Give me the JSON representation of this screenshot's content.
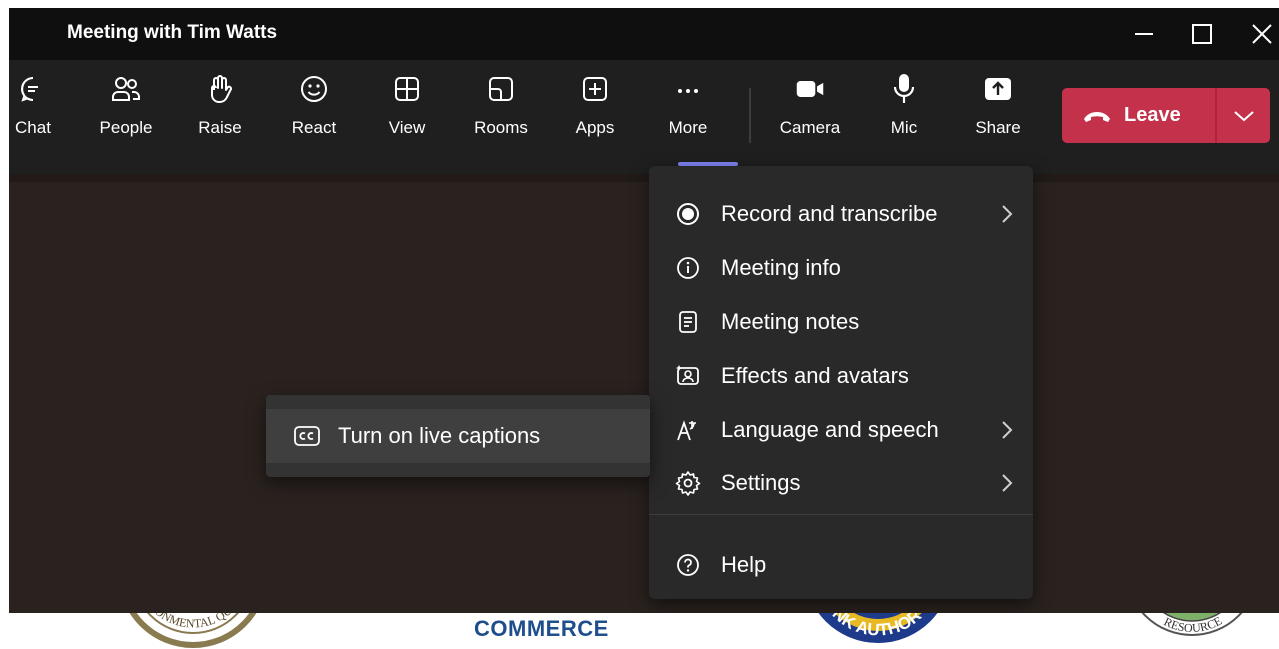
{
  "window": {
    "title": "Meeting with Tim Watts",
    "controls": [
      "minimize-icon",
      "maximize-icon",
      "close-icon"
    ]
  },
  "toolbar": {
    "items": [
      {
        "label": "Chat",
        "icon": "chat-icon"
      },
      {
        "label": "People",
        "icon": "people-icon"
      },
      {
        "label": "Raise",
        "icon": "raise-hand-icon"
      },
      {
        "label": "React",
        "icon": "smiley-icon"
      },
      {
        "label": "View",
        "icon": "view-grid-icon"
      },
      {
        "label": "Rooms",
        "icon": "rooms-icon"
      },
      {
        "label": "Apps",
        "icon": "apps-add-icon"
      },
      {
        "label": "More",
        "icon": "more-dots-icon",
        "active": true
      },
      {
        "label": "Camera",
        "icon": "camera-icon"
      },
      {
        "label": "Mic",
        "icon": "mic-icon"
      },
      {
        "label": "Share",
        "icon": "share-icon"
      }
    ],
    "leave_label": "Leave",
    "active_color": "#7f85f5",
    "leave_color": "#c4314b"
  },
  "more_menu": {
    "items": [
      {
        "label": "Record and transcribe",
        "icon": "record-icon",
        "submenu": true
      },
      {
        "label": "Meeting info",
        "icon": "info-icon",
        "submenu": false
      },
      {
        "label": "Meeting notes",
        "icon": "notes-icon",
        "submenu": false
      },
      {
        "label": "Effects and avatars",
        "icon": "effects-icon",
        "submenu": false
      },
      {
        "label": "Language and speech",
        "icon": "language-icon",
        "submenu": true
      },
      {
        "label": "Settings",
        "icon": "gear-icon",
        "submenu": true
      },
      {
        "label": "Help",
        "icon": "help-icon",
        "submenu": false
      }
    ]
  },
  "language_submenu": {
    "items": [
      {
        "label": "Turn on live captions",
        "icon": "captions-cc-icon"
      }
    ]
  },
  "background": {
    "visible_text": "COMMERCE",
    "seal_fragments": [
      "RONMENTAL QU",
      "NK AUTHOR",
      "RESOURCE"
    ]
  }
}
